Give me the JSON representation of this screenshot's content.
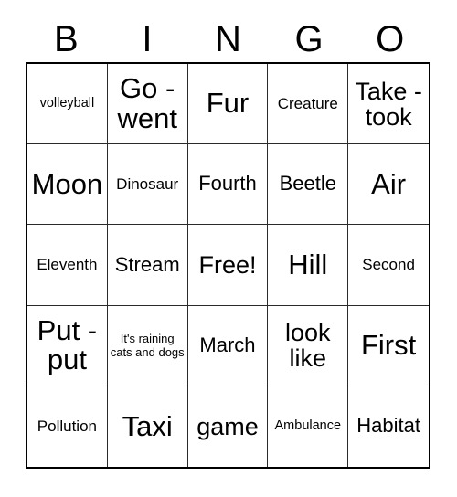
{
  "card": {
    "title": "BINGO",
    "header": {
      "letters": [
        {
          "label": "B",
          "name": "column-header-b"
        },
        {
          "label": "I",
          "name": "column-header-i"
        },
        {
          "label": "N",
          "name": "column-header-n"
        },
        {
          "label": "G",
          "name": "column-header-g"
        },
        {
          "label": "O",
          "name": "column-header-o"
        }
      ]
    },
    "colors": {
      "background": "#ffffff",
      "text": "#000000",
      "grid_border": "#000000",
      "cell_border": "#2b2b2b"
    },
    "grid": {
      "rows": 5,
      "columns": 5,
      "free_space": "Free!",
      "cells": [
        {
          "text": "volleyball",
          "size": "xs"
        },
        {
          "text": "Go - went",
          "size": "xl"
        },
        {
          "text": "Fur",
          "size": "xl"
        },
        {
          "text": "Creature",
          "size": "sm"
        },
        {
          "text": "Take - took",
          "size": "lg"
        },
        {
          "text": "Moon",
          "size": "xl"
        },
        {
          "text": "Dinosaur",
          "size": "sm"
        },
        {
          "text": "Fourth",
          "size": "md"
        },
        {
          "text": "Beetle",
          "size": "md"
        },
        {
          "text": "Air",
          "size": "xl"
        },
        {
          "text": "Eleventh",
          "size": "sm"
        },
        {
          "text": "Stream",
          "size": "md"
        },
        {
          "text": "Free!",
          "size": "lg"
        },
        {
          "text": "Hill",
          "size": "xl"
        },
        {
          "text": "Second",
          "size": "sm"
        },
        {
          "text": "Put - put",
          "size": "xl"
        },
        {
          "text": "It's raining cats and dogs",
          "size": "xxs"
        },
        {
          "text": "March",
          "size": "md"
        },
        {
          "text": "look like",
          "size": "lg"
        },
        {
          "text": "First",
          "size": "xl"
        },
        {
          "text": "Pollution",
          "size": "sm"
        },
        {
          "text": "Taxi",
          "size": "xl"
        },
        {
          "text": "game",
          "size": "lg"
        },
        {
          "text": "Ambulance",
          "size": "xs"
        },
        {
          "text": "Habitat",
          "size": "md"
        }
      ]
    }
  }
}
